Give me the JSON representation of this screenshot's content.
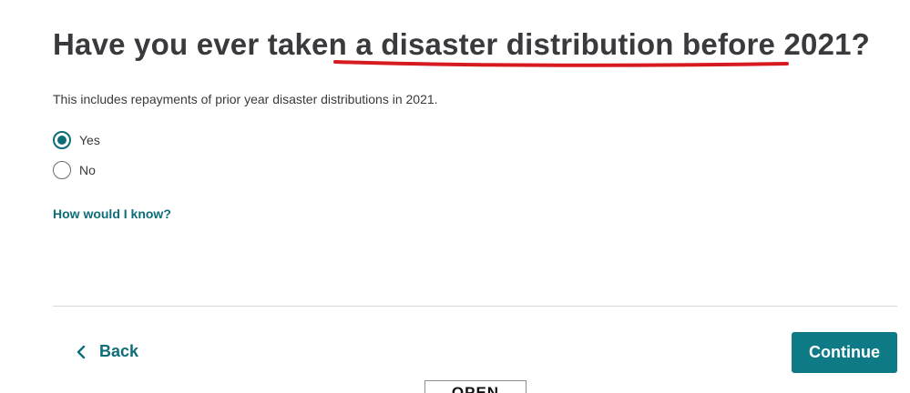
{
  "question": {
    "title": "Have you ever taken a disaster distribution before 2021?",
    "subtitle": "This includes repayments of prior year disaster distributions in 2021."
  },
  "options": [
    {
      "label": "Yes",
      "selected": true
    },
    {
      "label": "No",
      "selected": false
    }
  ],
  "help_link": "How would I know?",
  "navigation": {
    "back_label": "Back",
    "continue_label": "Continue"
  },
  "bottom_tab": {
    "label": "OPEN"
  },
  "colors": {
    "accent": "#0d6e79",
    "continue_bg": "#0d7a86",
    "annotation_underline": "#d71920"
  },
  "icons": {
    "back": "chevron-left-icon",
    "radio_selected": "radio-checked-icon",
    "radio_unselected": "radio-unchecked-icon"
  }
}
